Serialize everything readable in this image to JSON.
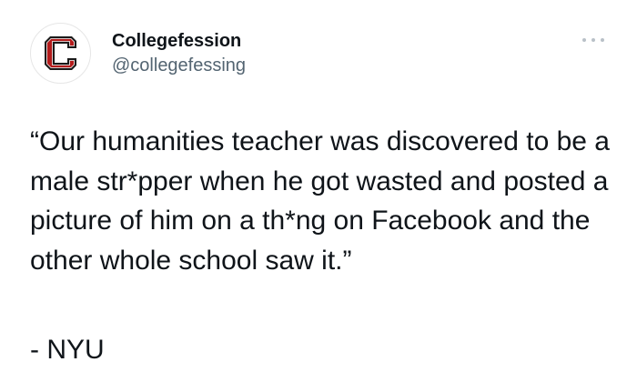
{
  "account": {
    "display_name": "Collegefession",
    "handle": "@collegefessing",
    "avatar_icon": "letter-c-logo",
    "avatar_letter": "C",
    "brand_color": "#b31b1b"
  },
  "more_icon": "ellipsis-icon",
  "tweet": {
    "text": "“Our humanities teacher was discovered to be a male str*pper when he got wasted and posted a picture of him on a th*ng on Facebook and the other whole school saw it.”",
    "signature": "- NYU"
  }
}
